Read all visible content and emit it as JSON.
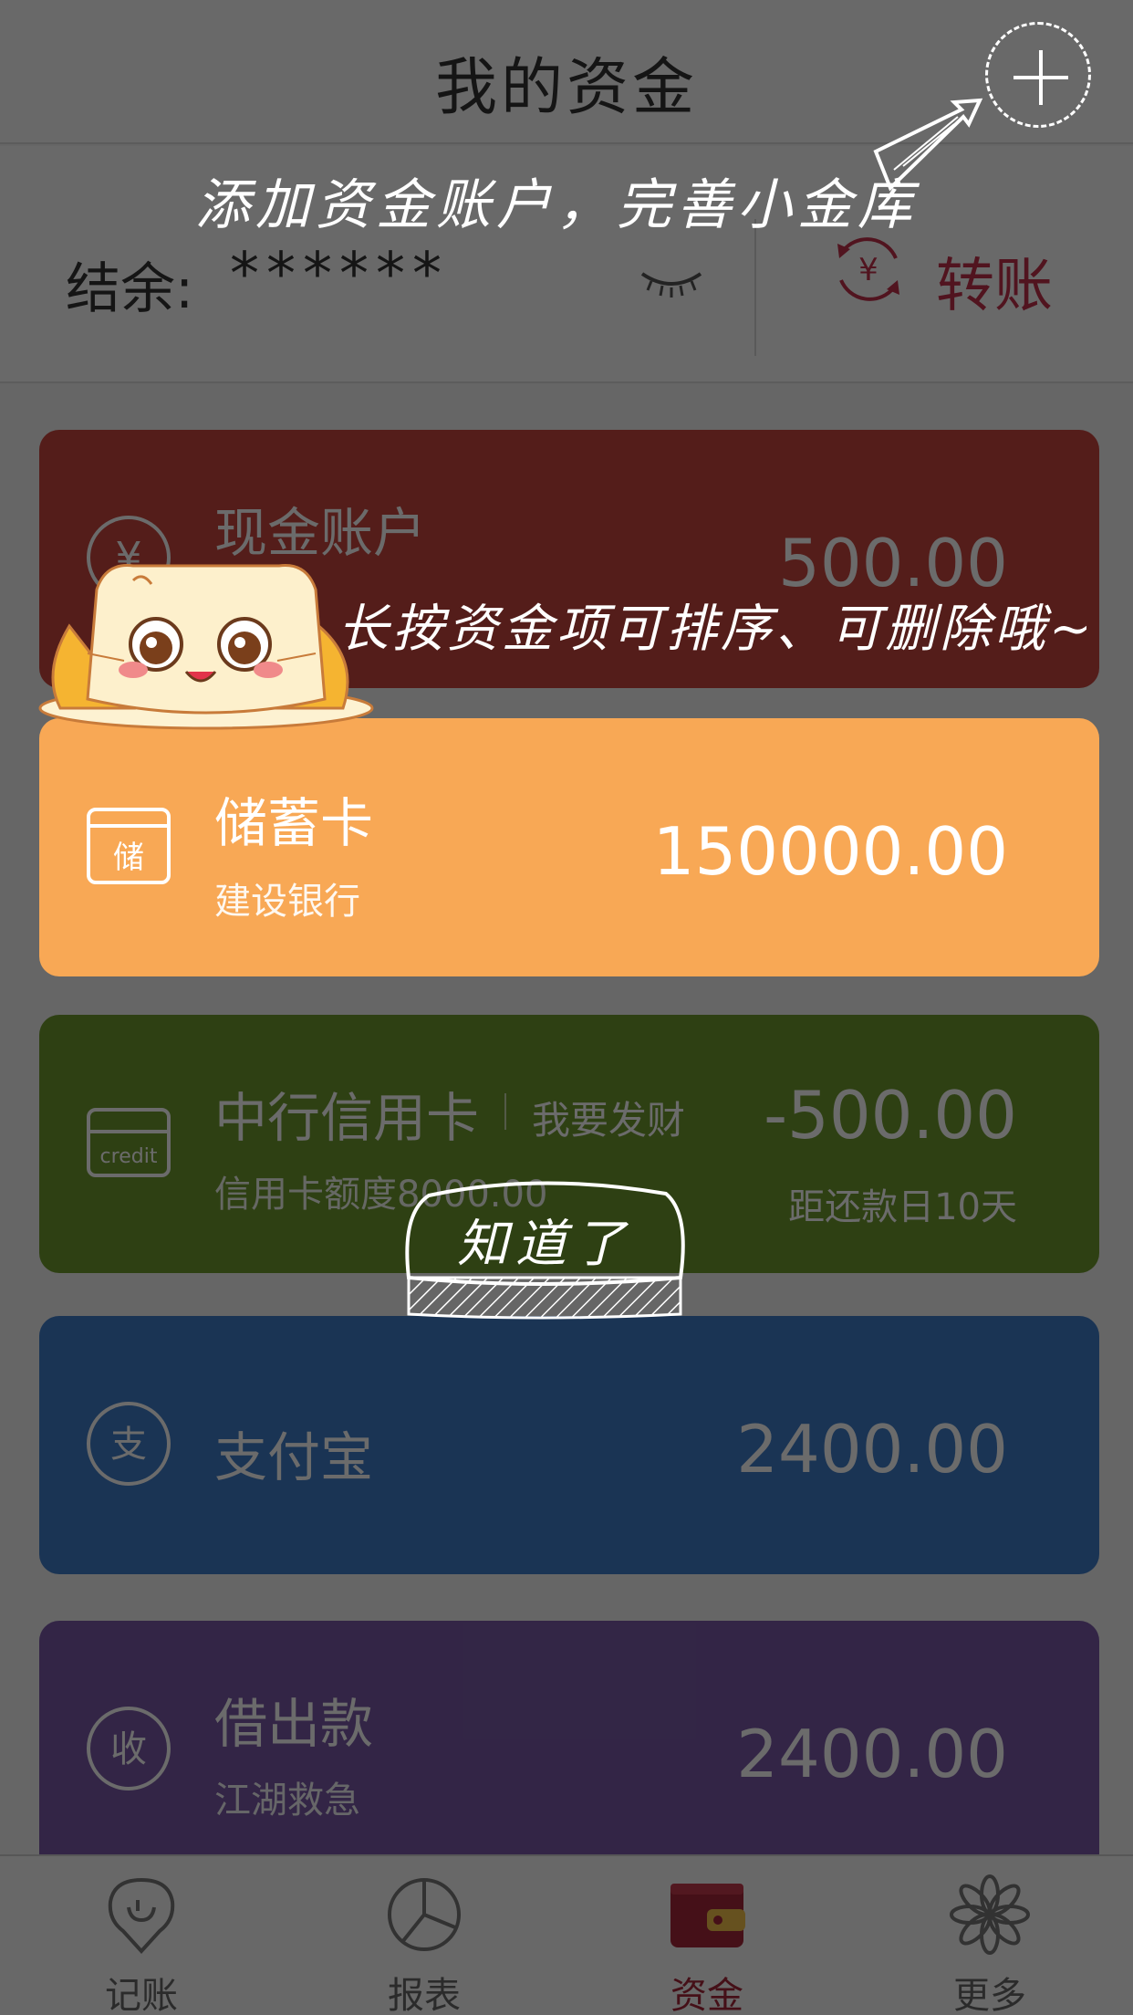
{
  "header": {
    "title": "我的资金",
    "add_icon": "plus-icon"
  },
  "balance": {
    "label": "结余:",
    "value": "******",
    "eye_icon": "eye-closed-icon",
    "transfer_icon": "yen-transfer-icon",
    "transfer_label": "转账",
    "transfer_color": "#c0304a"
  },
  "accounts": [
    {
      "name": "现金账户",
      "amount": "500.00",
      "icon": "yen-icon",
      "color": "#c8453e"
    },
    {
      "name": "储蓄卡",
      "sub": "建设银行",
      "amount": "150000.00",
      "icon": "savings-card-icon",
      "icon_text": "储",
      "color": "#f8a855"
    },
    {
      "name": "中行信用卡",
      "tag": "我要发财",
      "sub": "信用卡额度8000.00",
      "amount": "-500.00",
      "due": "距还款日10天",
      "icon": "credit-card-icon",
      "icon_text": "credit",
      "color": "#6f9a2f"
    },
    {
      "name": "支付宝",
      "amount": "2400.00",
      "icon": "alipay-icon",
      "icon_text": "支",
      "color": "#3f7cc8"
    },
    {
      "name": "借出款",
      "sub": "江湖救急",
      "amount": "2400.00",
      "icon": "loan-out-icon",
      "icon_text": "收",
      "color": "#7a5aa8"
    }
  ],
  "tabbar": [
    {
      "label": "记账",
      "icon": "bookkeeping-icon"
    },
    {
      "label": "报表",
      "icon": "pie-chart-icon"
    },
    {
      "label": "资金",
      "icon": "wallet-icon",
      "active": true
    },
    {
      "label": "更多",
      "icon": "flower-more-icon"
    }
  ],
  "guide": {
    "hint_add": "添加资金账户，完善小金库",
    "hint_sort": "长按资金项可排序、可删除哦~",
    "got_it": "知道了",
    "mascot": "cat-mascot"
  }
}
